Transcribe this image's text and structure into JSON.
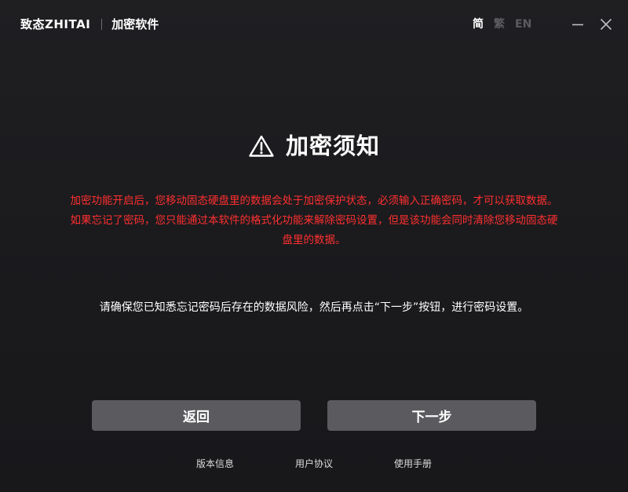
{
  "titlebar": {
    "brand_logo": "致态ZHITAI",
    "app_name": "加密软件",
    "languages": [
      {
        "label": "简",
        "active": true
      },
      {
        "label": "繁",
        "active": false
      },
      {
        "label": "EN",
        "active": false
      }
    ],
    "minimize_icon": "minimize-icon",
    "close_icon": "close-icon"
  },
  "main": {
    "heading_icon": "warning-triangle-icon",
    "heading_title": "加密须知",
    "warning_text": "加密功能开启后，您移动固态硬盘里的数据会处于加密保护状态，必须输入正确密码，才可以获取数据。如果忘记了密码，您只能通过本软件的格式化功能来解除密码设置，但是该功能会同时清除您移动固态硬盘里的数据。",
    "confirm_text": "请确保您已知悉忘记密码后存在的数据风险，然后再点击“下一步”按钮，进行密码设置。",
    "buttons": {
      "back_label": "返回",
      "next_label": "下一步"
    }
  },
  "footer": {
    "links": [
      "版本信息",
      "用户协议",
      "使用手册"
    ]
  },
  "colors": {
    "background": "#1c1c1f",
    "warning_red": "#ff2f2f",
    "button_gray": "#5a5a5f",
    "inactive_lang": "#5b5b60"
  }
}
